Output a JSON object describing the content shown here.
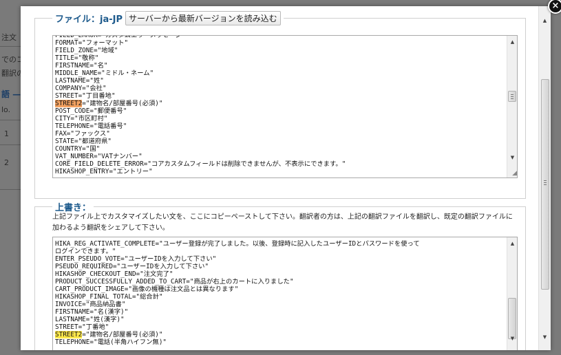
{
  "background": {
    "items": [
      "注文",
      "でのコ",
      "翻訳の",
      "語 —",
      "lo.",
      "1",
      "2"
    ]
  },
  "modal": {
    "file_section": {
      "legend": "ファイル：ja-JP",
      "load_button": "サーバーから最新バージョンを読み込む",
      "lines": [
        "FIELD_ERROR=\"カスタムエラーメッセージ\"",
        "FORMAT=\"フォーマット\"",
        "FIELD_ZONE=\"地域\"",
        "TITLE=\"敬称\"",
        "FIRSTNAME=\"名\"",
        "MIDDLE_NAME=\"ミドル・ネーム\"",
        "LASTNAME=\"姓\"",
        "COMPANY=\"会社\"",
        "STREET=\"丁目番地\"",
        "=\"建物名/部屋番号(必須)\"",
        "POST_CODE=\"郵便番号\"",
        "CITY=\"市区町村\"",
        "TELEPHONE=\"電話番号\"",
        "FAX=\"ファックス\"",
        "STATE=\"都道府県\"",
        "COUNTRY=\"国\"",
        "VAT_NUMBER=\"VATナンバー\"",
        "CORE_FIELD_DELETE_ERROR=\"コアカスタムフィールドは削除できませんが、不表示にできます。\"",
        "HIKASHOP_ENTRY=\"エントリー\""
      ],
      "highlight_key": "STREET2"
    },
    "override_section": {
      "legend": "上書き：",
      "description": "上記ファイル上でカスタマイズしたい文を、ここにコピーペーストして下さい。翻訳者の方は、上記の翻訳ファイルを翻訳し、既定の翻訳ファイルに加わるよう翻訳をシェアして下さい。",
      "lines": [
        "HIKA_REG_ACTIVATE_COMPLETE=\"ユーザー登録が完了しました。以後、登録時に記入したユーザーIDとパスワードを使って",
        "ログインできます。\"",
        "ENTER_PSEUDO_VOTE=\"ユーザーIDを入力して下さい\"",
        "PSEUDO_REQUIRED=\"ユーザーIDを入力して下さい\"",
        "HIKASHOP_CHECKOUT_END=\"注文完了\"",
        "PRODUCT_SUCCESSFULLY_ADDED_TO_CART=\"商品が右上のカートに入りました\"",
        "CART_PRODUCT_IMAGE=\"画像の機種は注文品とは異なります\"",
        "HIKASHOP_FINAL_TOTAL=\"総合計\"",
        "INVOICE=\"商品納品書\"",
        "FIRSTNAME=\"名(漢字)\"",
        "LASTNAME=\"姓(漢字)\"",
        "STREET=\"丁番地\"",
        "=\"建物名/部屋番号(必須)\"",
        "TELEPHONE=\"電話(半角ハイフン無)\""
      ],
      "highlight_key": "STREET2"
    },
    "close_glyph": "×",
    "scroll_up_glyph": "▲",
    "scroll_down_glyph": "▼",
    "resize_glyph": "◢"
  }
}
